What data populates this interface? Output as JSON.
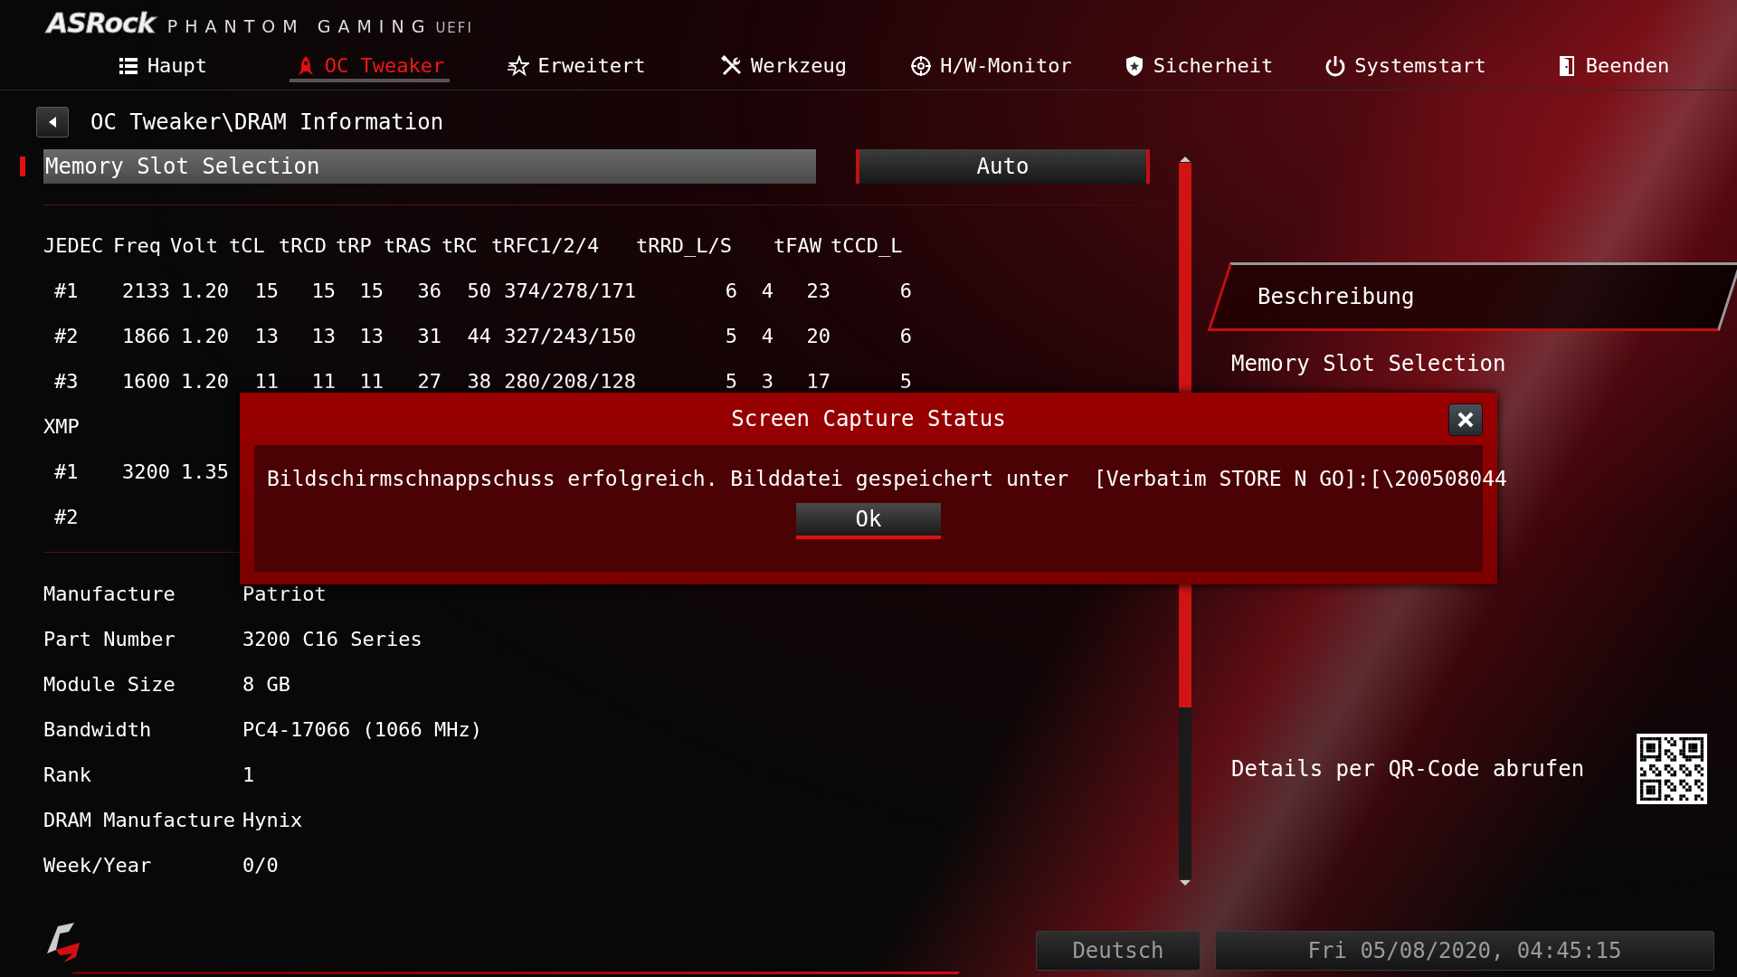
{
  "brand": {
    "logo": "ASRock",
    "product": "PHANTOM GAMING",
    "suffix": "UEFI"
  },
  "tabs": [
    {
      "label": "Haupt",
      "selected": false
    },
    {
      "label": "OC Tweaker",
      "selected": true
    },
    {
      "label": "Erweitert",
      "selected": false
    },
    {
      "label": "Werkzeug",
      "selected": false
    },
    {
      "label": "H/W-Monitor",
      "selected": false
    },
    {
      "label": "Sicherheit",
      "selected": false
    },
    {
      "label": "Systemstart",
      "selected": false
    },
    {
      "label": "Beenden",
      "selected": false
    }
  ],
  "breadcrumb": "OC Tweaker\\DRAM Information",
  "setting": {
    "label": "Memory Slot Selection",
    "value": "Auto",
    "selected": true
  },
  "timings": {
    "columns": [
      "JEDEC",
      "Freq",
      "Volt",
      "tCL",
      "tRCD",
      "tRP",
      "tRAS",
      "tRC",
      "tRFC1/2/4",
      "tRRD_L/S",
      "",
      "tFAW",
      "tCCD_L"
    ],
    "rows": [
      {
        "kind": "profile",
        "cells": [
          "#1",
          "2133",
          "1.20",
          "15",
          "15",
          "15",
          "36",
          "50",
          "374/278/171",
          "6",
          "4",
          "23",
          "6"
        ]
      },
      {
        "kind": "profile",
        "cells": [
          "#2",
          "1866",
          "1.20",
          "13",
          "13",
          "13",
          "31",
          "44",
          "327/243/150",
          "5",
          "4",
          "20",
          "6"
        ]
      },
      {
        "kind": "profile",
        "cells": [
          "#3",
          "1600",
          "1.20",
          "11",
          "11",
          "11",
          "27",
          "38",
          "280/208/128",
          "5",
          "3",
          "17",
          "5"
        ]
      },
      {
        "kind": "section",
        "label": "XMP"
      },
      {
        "kind": "profile",
        "cells": [
          "#1",
          "3200",
          "1.35"
        ]
      },
      {
        "kind": "profile",
        "cells": [
          "#2"
        ]
      }
    ]
  },
  "module_info": [
    {
      "label": "Manufacture",
      "value": "Patriot"
    },
    {
      "label": "Part Number",
      "value": "3200 C16 Series"
    },
    {
      "label": "Module Size",
      "value": "8 GB"
    },
    {
      "label": "Bandwidth",
      "value": "PC4-17066 (1066 MHz)"
    },
    {
      "label": "Rank",
      "value": "1"
    },
    {
      "label": "DRAM Manufacture",
      "value": "Hynix"
    },
    {
      "label": "Week/Year",
      "value": "0/0"
    }
  ],
  "description": {
    "title": "Beschreibung",
    "text": "Memory Slot Selection",
    "qr_hint": "Details per QR-Code abrufen"
  },
  "dialog": {
    "title": "Screen Capture Status",
    "message": "Bildschirmschnappschuss erfolgreich. Bilddatei gespeichert unter  [Verbatim STORE N GO]:[\\200508044",
    "button": "Ok"
  },
  "status_bar": {
    "language": "Deutsch",
    "datetime": "Fri 05/08/2020, 04:45:15"
  }
}
